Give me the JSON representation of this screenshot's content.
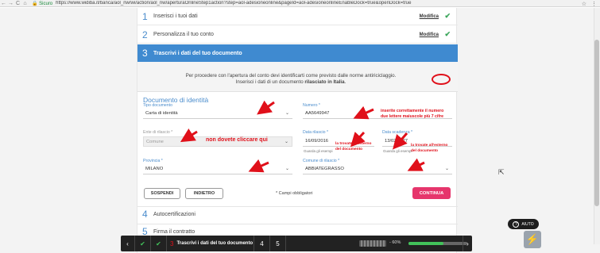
{
  "browser": {
    "back": "←",
    "forward": "→",
    "reload": "C",
    "home": "⌂",
    "secure_label": "Sicuro",
    "url": "https://www.widiba.it/banca/aol_nw/wi/action/aol_nw/aperturaOnlineStep1action?step=aol-adesioneonline&pageId=aol-adesioneonlineEnableDock=true&openDock=true"
  },
  "steps_done": [
    {
      "num": "1",
      "title": "Inserisci i tuoi dati",
      "edit": "Modifica"
    },
    {
      "num": "2",
      "title": "Personalizza il tuo conto",
      "edit": "Modifica"
    }
  ],
  "active_step": {
    "num": "3",
    "title": "Trascrivi i dati del tuo documento"
  },
  "intro": {
    "line1": "Per procedere con l'apertura del conto devi identificarti come previsto dalle norme antiriciclaggio.",
    "line2_prefix": "Inserisci i dati di un documento ",
    "line2_bold": "rilasciato in Italia",
    "line2_suffix": "."
  },
  "section_title": "Documento di identità",
  "form": {
    "tipo_label": "Tipo documento",
    "tipo_value": "Carta di identità",
    "numero_label": "Numero *",
    "numero_value": "AA5649947",
    "ente_label": "Ente di rilascio *",
    "ente_value": "Comune",
    "data_rilascio_label": "Data rilascio *",
    "data_rilascio_value": "16/09/2016",
    "data_rilascio_helper": "Guarda gli esempi",
    "data_scadenza_label": "Data scadenza *",
    "data_scadenza_value": "13/02/2027",
    "data_scadenza_helper": "Guarda gli esempi",
    "provincia_label": "Provincia *",
    "provincia_value": "MILANO",
    "comune_label": "Comune di rilascio *",
    "comune_value": "ABBIATEGRASSO"
  },
  "annotations": {
    "numero_note_1": "inserite correttamente il numero",
    "numero_note_2": "due lettere maiuscole più 7 cifre",
    "ente_note": "non dovete cliccare qui",
    "rilascio_note_1": "la trovate all'interno",
    "rilascio_note_2": "del documento",
    "scadenza_note_1": "la trovate all'esterno",
    "scadenza_note_2": "del documento"
  },
  "actions": {
    "suspend": "SOSPENDI",
    "back": "INDIETRO",
    "required_note": "* Campi obbligatori",
    "continue": "CONTINUA"
  },
  "steps_next": [
    {
      "num": "4",
      "title": "Autocertificazioni"
    },
    {
      "num": "5",
      "title": "Firma il contratto"
    }
  ],
  "bottom_bar": {
    "prev": "‹",
    "step_current": "3",
    "step_label": "Trascrivi i dati del tuo documento",
    "step4": "4",
    "step5": "5",
    "progress_text": "- 60%",
    "progress": 0.6,
    "next": "›"
  },
  "help": {
    "label": "AIUTO",
    "icon": "?"
  },
  "lightning": "⚡",
  "colors": {
    "primary_blue": "#3f8ad0",
    "cta_pink": "#e6356c",
    "check_green": "#3aa55a",
    "annotation_red": "#e0101a"
  }
}
